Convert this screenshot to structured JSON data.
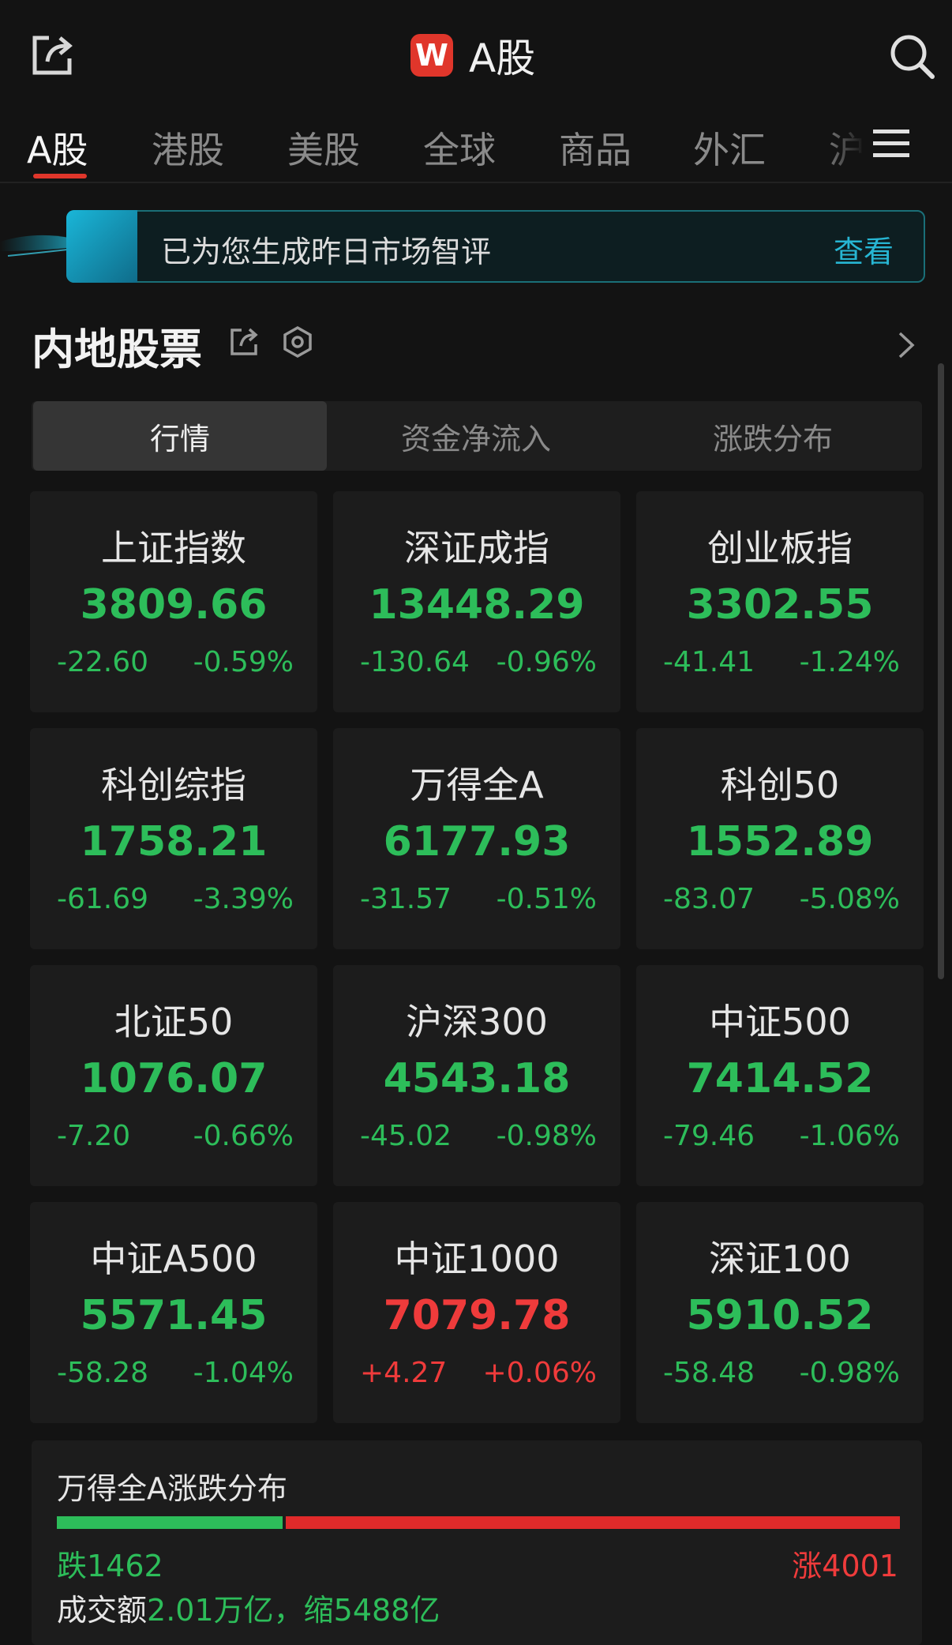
{
  "header": {
    "logo_letter": "W",
    "title": "A股",
    "icons": [
      "share-icon",
      "search-icon"
    ]
  },
  "tabs": [
    "A股",
    "港股",
    "美股",
    "全球",
    "商品",
    "外汇",
    "沪"
  ],
  "banner": {
    "text": "已为您生成昨日市场智评",
    "link": "查看"
  },
  "section": {
    "title": "内地股票"
  },
  "segments": [
    "行情",
    "资金净流入",
    "涨跌分布"
  ],
  "indices": [
    {
      "name": "上证指数",
      "value": "3809.66",
      "change": "-22.60",
      "pct": "-0.59%",
      "dir": "down"
    },
    {
      "name": "深证成指",
      "value": "13448.29",
      "change": "-130.64",
      "pct": "-0.96%",
      "dir": "down"
    },
    {
      "name": "创业板指",
      "value": "3302.55",
      "change": "-41.41",
      "pct": "-1.24%",
      "dir": "down"
    },
    {
      "name": "科创综指",
      "value": "1758.21",
      "change": "-61.69",
      "pct": "-3.39%",
      "dir": "down"
    },
    {
      "name": "万得全A",
      "value": "6177.93",
      "change": "-31.57",
      "pct": "-0.51%",
      "dir": "down"
    },
    {
      "name": "科创50",
      "value": "1552.89",
      "change": "-83.07",
      "pct": "-5.08%",
      "dir": "down"
    },
    {
      "name": "北证50",
      "value": "1076.07",
      "change": "-7.20",
      "pct": "-0.66%",
      "dir": "down"
    },
    {
      "name": "沪深300",
      "value": "4543.18",
      "change": "-45.02",
      "pct": "-0.98%",
      "dir": "down"
    },
    {
      "name": "中证500",
      "value": "7414.52",
      "change": "-79.46",
      "pct": "-1.06%",
      "dir": "down"
    },
    {
      "name": "中证A500",
      "value": "5571.45",
      "change": "-58.28",
      "pct": "-1.04%",
      "dir": "down"
    },
    {
      "name": "中证1000",
      "value": "7079.78",
      "change": "+4.27",
      "pct": "+0.06%",
      "dir": "up"
    },
    {
      "name": "深证100",
      "value": "5910.52",
      "change": "-58.48",
      "pct": "-0.98%",
      "dir": "down"
    }
  ],
  "distribution": {
    "title": "万得全A涨跌分布",
    "down_label": "跌1462",
    "up_label": "涨4001",
    "down_count": 1462,
    "up_count": 4001,
    "volume_prefix": "成交额",
    "volume_value": "2.01万亿，",
    "volume_suffix": "缩5488亿"
  },
  "colors": {
    "down": "#2dbd5a",
    "up": "#ef3b3b",
    "accent": "#e0362b",
    "banner": "#27b6d3"
  }
}
